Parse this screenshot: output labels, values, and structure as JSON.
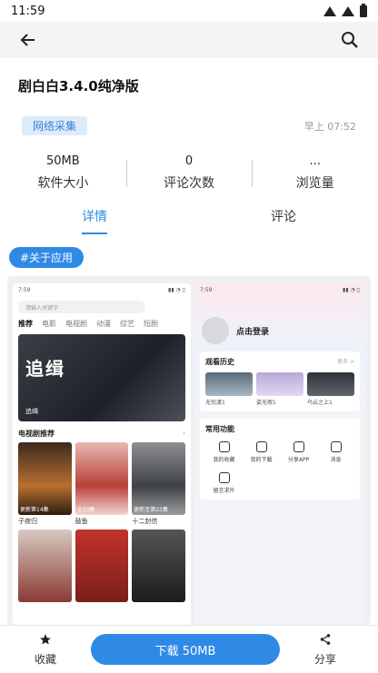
{
  "status": {
    "time": "11:59"
  },
  "header": {
    "back_icon": "arrow-left-icon",
    "search_icon": "search-icon"
  },
  "app": {
    "title": "剧白白3.4.0纯净版",
    "tag": "网络采集",
    "updated": "早上 07:52"
  },
  "stats": [
    {
      "value": "50MB",
      "label": "软件大小"
    },
    {
      "value": "0",
      "label": "评论次数"
    },
    {
      "value": "...",
      "label": "浏览量"
    }
  ],
  "tabs": [
    {
      "label": "详情",
      "active": true
    },
    {
      "label": "评论",
      "active": false
    }
  ],
  "section_pill": "#关于应用",
  "screenshot": {
    "left": {
      "time": "7:59",
      "search_placeholder": "请输入关键字",
      "nav": [
        "推荐",
        "电影",
        "电视剧",
        "动漫",
        "综艺",
        "短剧"
      ],
      "banner_title": "追缉",
      "banner_caption": "追缉",
      "section_title": "电视剧推荐",
      "row1": [
        "子夜归",
        "鼓鱼",
        "十二封信"
      ],
      "row1_overlay": [
        "更新第14集",
        "全30集",
        "更新至第23集"
      ]
    },
    "right": {
      "time": "7:59",
      "login": "点击登录",
      "history_title": "观看历史",
      "history_more": "更多 >",
      "history": [
        "无忧渡1",
        "姿无瑕1",
        "乌云之上1"
      ],
      "functions_title": "常用功能",
      "functions": [
        "我的收藏",
        "我的下载",
        "分享APP",
        "消息",
        "留言求片"
      ]
    }
  },
  "bottom": {
    "favorite": {
      "label": "收藏",
      "icon": "star-icon"
    },
    "download": "下载 50MB",
    "share": {
      "label": "分享",
      "icon": "share-icon"
    }
  }
}
